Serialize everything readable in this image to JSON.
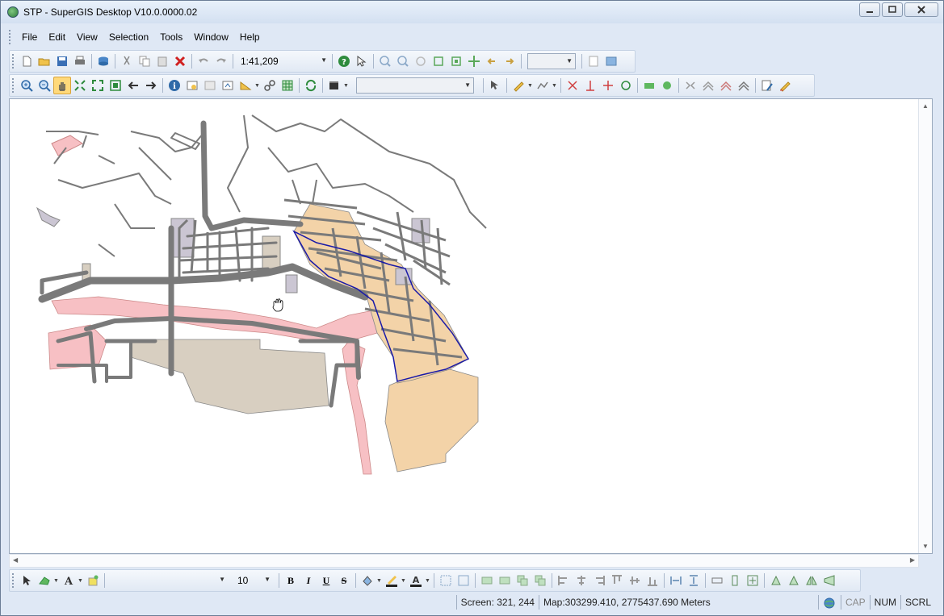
{
  "window": {
    "title": "STP - SuperGIS Desktop V10.0.0000.02",
    "controls": [
      "minimize",
      "maximize",
      "close"
    ]
  },
  "menu": {
    "items": [
      "File",
      "Edit",
      "View",
      "Selection",
      "Tools",
      "Window",
      "Help"
    ]
  },
  "standard_toolbar": {
    "scale": "1:41,209",
    "icons": [
      "new-icon",
      "open-icon",
      "save-icon",
      "print-icon",
      "add-data-icon",
      "cut-icon",
      "copy-icon",
      "paste-icon",
      "delete-icon",
      "undo-icon",
      "redo-icon",
      "help-icon",
      "whats-this-icon",
      "zoom-in-fixed-icon",
      "zoom-out-fixed-icon",
      "pan-fixed-icon",
      "full-extent-icon",
      "zoom-selected-icon",
      "center-icon",
      "back-icon",
      "forward-icon",
      "layout-icon",
      "map-icon"
    ]
  },
  "tools_toolbar": {
    "layer_combo": "",
    "icons": [
      "zoom-in-icon",
      "zoom-out-icon",
      "pan-icon",
      "full-extent-icon",
      "fixed-zoom-icon",
      "zoom-layer-icon",
      "previous-extent-icon",
      "next-extent-icon",
      "identify-icon",
      "find-icon",
      "select-features-icon",
      "select-by-graphics-icon",
      "measure-icon",
      "hyperlink-icon",
      "table-icon",
      "refresh-icon",
      "movie-icon",
      "edit-pointer-icon",
      "sketch-icon",
      "trace-icon",
      "split-icon",
      "vertex-icon",
      "intersection-icon",
      "circle-icon",
      "rectangle-icon",
      "ellipse-icon",
      "mirror-icon",
      "merge-icon",
      "union-icon",
      "intersect-icon",
      "attributes-icon",
      "pencil-icon"
    ]
  },
  "draw_toolbar": {
    "font_name": "",
    "font_size": "10",
    "bold": "B",
    "italic": "I",
    "underline": "U",
    "strikethrough": "S"
  },
  "status": {
    "screen": "Screen: 321, 244",
    "map": "Map:303299.410, 2775437.690 Meters",
    "cap": "CAP",
    "num": "NUM",
    "scrl": "SCRL"
  },
  "colors": {
    "road": "#7a7a7a",
    "pink_area": "#f7c0c4",
    "tan_area": "#d8cfc1",
    "orange_area": "#f3d3a8",
    "lavender_area": "#cbc6d3",
    "selection": "#1a1aa8"
  }
}
